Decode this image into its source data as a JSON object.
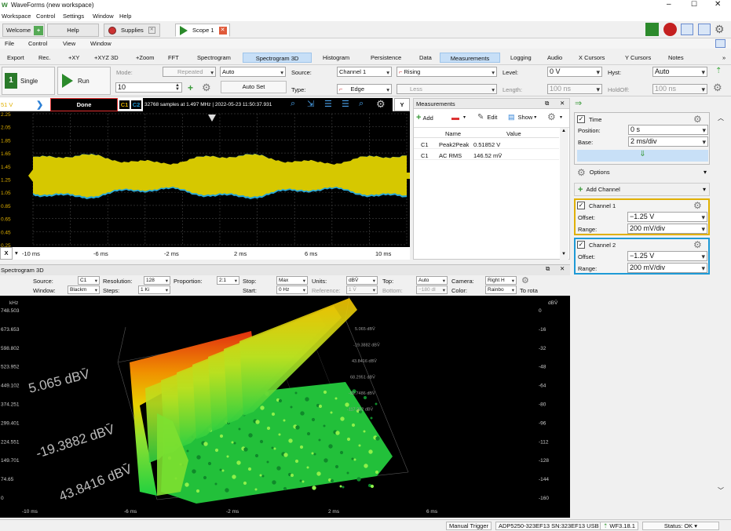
{
  "window": {
    "title": "WaveForms (new workspace)"
  },
  "menu": [
    "Workspace",
    "Control",
    "Settings",
    "Window",
    "Help"
  ],
  "tabs": [
    {
      "label": "Welcome"
    },
    {
      "label": "Help"
    },
    {
      "label": "Supplies"
    },
    {
      "label": "Scope 1"
    }
  ],
  "subtoolbar": [
    "File",
    "Control",
    "View",
    "Window"
  ],
  "instrument_tabs": [
    "Export",
    "Rec.",
    "+XY",
    "+XYZ 3D",
    "+Zoom",
    "FFT",
    "Spectrogram",
    "Spectrogram 3D",
    "Histogram",
    "Persistence",
    "Data",
    "Measurements",
    "Logging",
    "Audio",
    "X Cursors",
    "Y Cursors",
    "Notes"
  ],
  "trigger": {
    "single_label": "Single",
    "run_label": "Run",
    "mode_label": "Mode:",
    "mode_value": "Repeated",
    "auto_value": "Auto",
    "count_value": "10",
    "autoset_label": "Auto Set",
    "source_label": "Source:",
    "source_value": "Channel 1",
    "edge_dir": "Rising",
    "type_label": "Type:",
    "type_value": "Edge",
    "less_value": "Less",
    "level_label": "Level:",
    "level_value": "0 V",
    "length_label": "Length:",
    "length_value": "100 ns",
    "hyst_label": "Hyst:",
    "hyst_value": "Auto",
    "holdoff_label": "HoldOff:",
    "holdoff_value": "100 ns"
  },
  "scope": {
    "volt_label": "51 V",
    "status": "Done",
    "c1": "C1",
    "c2": "C2",
    "info": "32768 samples at 1.497 MHz | 2022-05-23 11:50:37.931",
    "y_btn": "Y",
    "y_ticks": [
      "2.25",
      "2.05",
      "1.85",
      "1.65",
      "1.45",
      "1.25",
      "1.05",
      "0.85",
      "0.65",
      "0.45",
      "0.25"
    ],
    "x_ticks": [
      "-10 ms",
      "-6 ms",
      "-2 ms",
      "2 ms",
      "6 ms",
      "10 ms"
    ],
    "x_btn": "X",
    "colors": {
      "ch1": "#d6c800",
      "ch2": "#2aa8d8"
    }
  },
  "measurements": {
    "title": "Measurements",
    "add_label": "Add",
    "edit_label": "Edit",
    "show_label": "Show",
    "columns": [
      "Name",
      "Value"
    ],
    "rows": [
      {
        "ch": "C1",
        "name": "Peak2Peak",
        "value": "0.51852 V"
      },
      {
        "ch": "C1",
        "name": "AC RMS",
        "value": "146.52 mV̄"
      }
    ]
  },
  "time": {
    "title": "Time",
    "position_label": "Position:",
    "position_value": "0 s",
    "base_label": "Base:",
    "base_value": "2 ms/div",
    "options_label": "Options",
    "add_channel_label": "Add Channel"
  },
  "channels": [
    {
      "title": "Channel 1",
      "offset_label": "Offset:",
      "offset": "−1.25 V",
      "range_label": "Range:",
      "range": "200 mV/div",
      "color": "#e0b000"
    },
    {
      "title": "Channel 2",
      "offset_label": "Offset:",
      "offset": "−1.25 V",
      "range_label": "Range:",
      "range": "200 mV/div",
      "color": "#1e9ad6"
    }
  ],
  "spectrogram": {
    "title": "Spectrogram 3D",
    "source_label": "Source:",
    "source": "C1",
    "resolution_label": "Resolution:",
    "resolution": "128",
    "proportion_label": "Proportion:",
    "proportion": "2:1",
    "stop_label": "Stop:",
    "stop": "Max",
    "units_label": "Units:",
    "units": "dBV̄",
    "top_label": "Top:",
    "top": "Auto",
    "camera_label": "Camera:",
    "camera": "Right H",
    "window_label": "Window:",
    "window": "Blackm",
    "steps_label": "Steps:",
    "steps": "1 Ki",
    "start_label": "Start:",
    "start": "0 Hz",
    "reference_label": "Reference:",
    "reference": "1 V̄",
    "bottom_label": "Bottom:",
    "bottom": "−180 dI",
    "color_label": "Color:",
    "color": "Rainbo",
    "rotate_label": "To rota",
    "y_unit": "kHz",
    "z_unit": "dBV̄",
    "freq_ticks": [
      "748.503",
      "673.653",
      "598.802",
      "523.952",
      "449.102",
      "374.251",
      "299.401",
      "224.551",
      "149.701",
      "74.65",
      "0"
    ],
    "db_ticks": [
      "0",
      "-16",
      "-32",
      "-48",
      "-64",
      "-80",
      "-96",
      "-112",
      "-128",
      "-144",
      "-160"
    ],
    "x_ticks": [
      "-10 ms",
      "-6 ms",
      "-2 ms",
      "2 ms",
      "6 ms"
    ],
    "surface_labels": [
      "5.065 dBV̄",
      "-19.3882 dBV̄",
      "43.8416 dBV̄"
    ],
    "small_labels": [
      "5.065 dBV̄",
      "-19.3882 dBV̄",
      "43.8416 dBV̄",
      "68.2951 dBV̄",
      "-92.7486 dBV̄",
      "-117.202 dBV̄"
    ]
  },
  "status": {
    "trigger": "Manual Trigger",
    "device": "ADP5250-323EF13 SN:323EF13 USB",
    "version": "WF3.18.1",
    "status": "Status: OK"
  }
}
